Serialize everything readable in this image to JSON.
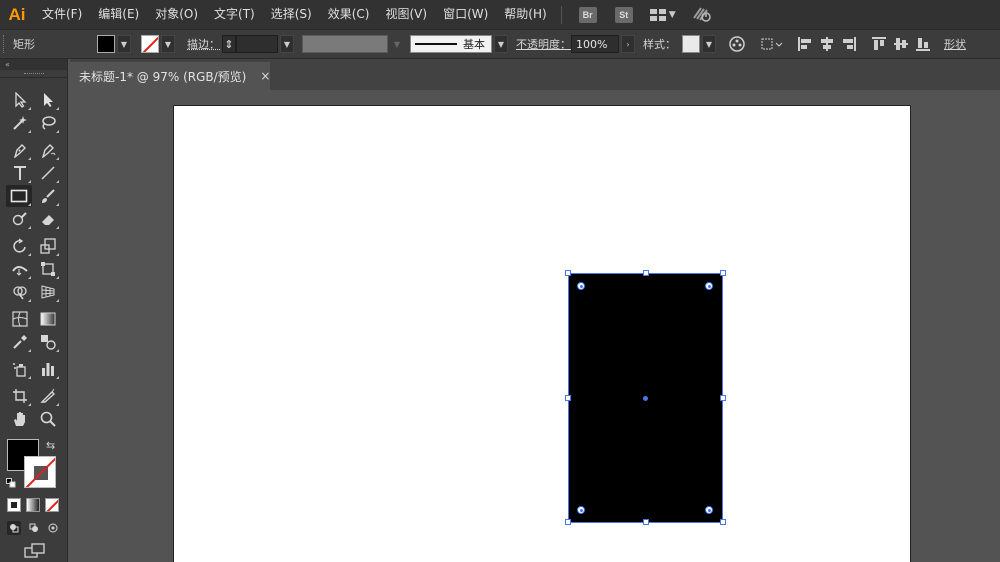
{
  "app": {
    "logo": "Ai",
    "accent": "#ff9a00"
  },
  "menu": {
    "items": [
      "文件(F)",
      "编辑(E)",
      "对象(O)",
      "文字(T)",
      "选择(S)",
      "效果(C)",
      "视图(V)",
      "窗口(W)",
      "帮助(H)"
    ],
    "bridge_label": "Br",
    "stock_label": "St"
  },
  "control": {
    "tool_name": "矩形",
    "fill_color": "#000000",
    "stroke_color": "none",
    "stroke_label": "描边：",
    "brush_label": "基本",
    "opacity_label": "不透明度：",
    "opacity_value": "100%",
    "style_label": "样式：",
    "shape_label": "形状"
  },
  "document": {
    "tab_title": "未标题-1* @ 97% (RGB/预览)",
    "close_glyph": "×"
  },
  "toolbox": {
    "collapse_glyph": "«",
    "tools": [
      "selection-tool",
      "direct-selection-tool",
      "magic-wand-tool",
      "lasso-tool",
      "pen-tool",
      "curvature-tool",
      "type-tool",
      "line-segment-tool",
      "rectangle-tool",
      "paintbrush-tool",
      "shaper-tool",
      "eraser-tool",
      "rotate-tool",
      "scale-tool",
      "width-tool",
      "free-transform-tool",
      "shape-builder-tool",
      "perspective-grid-tool",
      "mesh-tool",
      "gradient-tool",
      "eyedropper-tool",
      "blend-tool",
      "symbol-sprayer-tool",
      "column-graph-tool",
      "artboard-tool",
      "slice-tool",
      "hand-tool",
      "zoom-tool"
    ],
    "active_tool": "rectangle-tool"
  },
  "canvas": {
    "artboard_color": "#ffffff",
    "shape": {
      "type": "rectangle",
      "fill": "#000000",
      "selection_color": "#4a76e8"
    }
  }
}
